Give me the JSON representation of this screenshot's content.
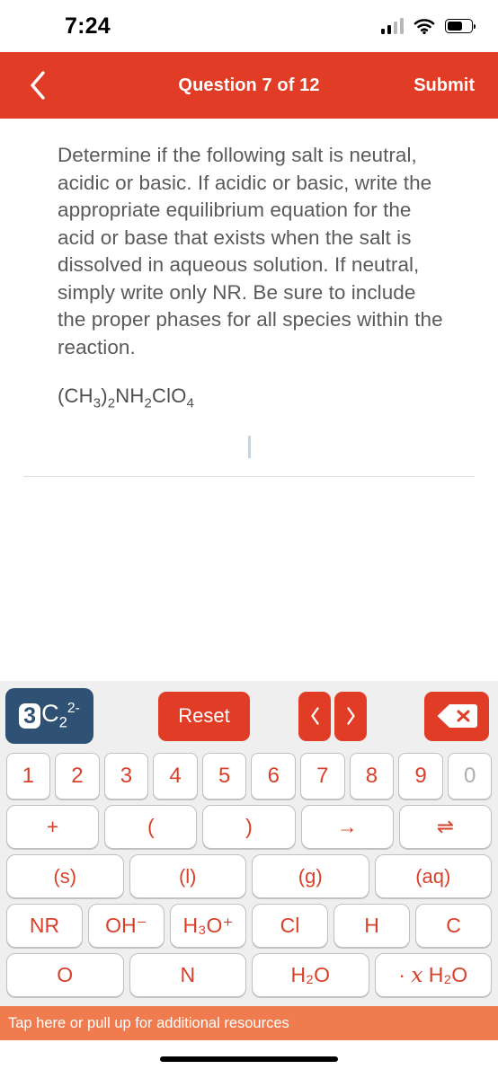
{
  "status_bar": {
    "time": "7:24",
    "signal_icon": "cellular-signal-icon",
    "wifi_icon": "wifi-icon",
    "battery_icon": "battery-icon",
    "battery_level_pct": 62
  },
  "nav": {
    "back_icon": "chevron-left-icon",
    "title": "Question 7 of 12",
    "submit_label": "Submit"
  },
  "question": {
    "prompt": "Determine if the following salt is neutral, acidic or basic. If acidic or basic, write the appropriate equilibrium equation for the acid or base that exists when the salt is dissolved in aqueous solution. If neutral, simply write only NR. Be sure to include the proper phases for all species within the reaction.",
    "formula_parts": [
      {
        "t": "(CH"
      },
      {
        "t": "3",
        "sub": true
      },
      {
        "t": ")"
      },
      {
        "t": "2",
        "sub": true
      },
      {
        "t": "NH"
      },
      {
        "t": "2",
        "sub": true
      },
      {
        "t": "ClO"
      },
      {
        "t": "4",
        "sub": true
      }
    ],
    "formula_plain": "(CH3)2NH2ClO4",
    "answer_value": "",
    "caret_visible": true
  },
  "keyboard": {
    "coefficient_key": {
      "name": "coefficient-subscript-charge-key",
      "coefficient": "3",
      "element": "C",
      "subscript": "2",
      "superscript": "2-"
    },
    "reset_label": "Reset",
    "prev_icon": "chevron-left-icon",
    "next_icon": "chevron-right-icon",
    "backspace_icon": "backspace-icon",
    "numbers": [
      {
        "label": "1",
        "disabled": false
      },
      {
        "label": "2",
        "disabled": false
      },
      {
        "label": "3",
        "disabled": false
      },
      {
        "label": "4",
        "disabled": false
      },
      {
        "label": "5",
        "disabled": false
      },
      {
        "label": "6",
        "disabled": false
      },
      {
        "label": "7",
        "disabled": false
      },
      {
        "label": "8",
        "disabled": false
      },
      {
        "label": "9",
        "disabled": false
      },
      {
        "label": "0",
        "disabled": true
      }
    ],
    "operators": [
      "+",
      "(",
      ")",
      "→",
      "⇌"
    ],
    "phases": [
      "(s)",
      "(l)",
      "(g)",
      "(aq)"
    ],
    "species": [
      "NR",
      "OH⁻",
      "H₃O⁺",
      "Cl",
      "H",
      "C"
    ],
    "elements": [
      "O",
      "N",
      "H₂O",
      "· x H₂O"
    ]
  },
  "resources": {
    "label": "Tap here or pull up for additional resources"
  },
  "colors": {
    "brand_red": "#E03C26",
    "key_red_text": "#d8402a",
    "coefficient_blue": "#2f5274",
    "resources_orange": "#F07B4E",
    "keyboard_bg": "#efefef",
    "question_text": "#5a5a5a",
    "disabled_key": "#adadad"
  }
}
